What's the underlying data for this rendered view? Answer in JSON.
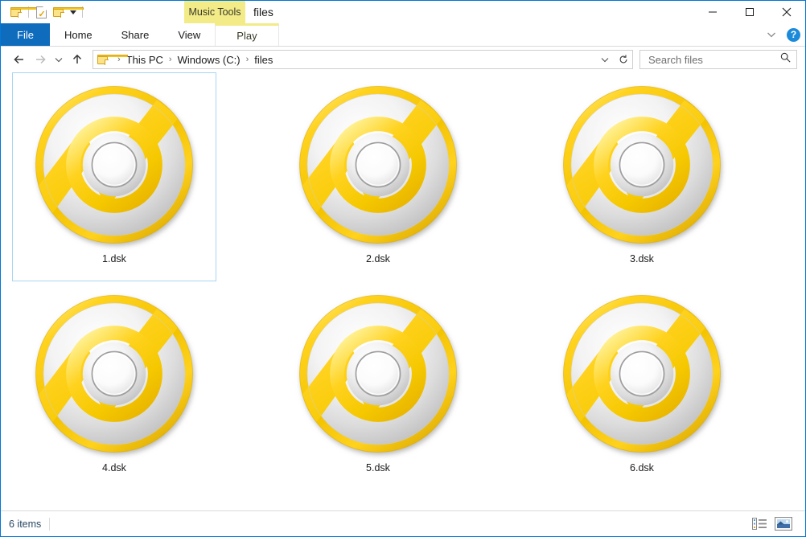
{
  "window": {
    "title": "files",
    "contextual_tab_group": "Music Tools",
    "colors": {
      "accent": "#0078d7",
      "file_tab": "#0f6cbd",
      "contextual": "#f2eb87",
      "selection_border": "#a9d5f2",
      "disc_gold": "#ffd21e",
      "disc_silver": "#e8e8e8"
    }
  },
  "quick_access": {
    "items": [
      {
        "name": "folder-icon",
        "label": ""
      },
      {
        "name": "properties-icon",
        "label": ""
      },
      {
        "name": "new-folder-icon",
        "label": ""
      },
      {
        "name": "customize-caret",
        "label": ""
      }
    ]
  },
  "window_controls": {
    "minimize": "—",
    "maximize": "□",
    "close": "✕",
    "help": "?"
  },
  "ribbon": {
    "tabs": [
      {
        "label": "File",
        "active": false,
        "type": "file"
      },
      {
        "label": "Home",
        "active": false,
        "type": "normal"
      },
      {
        "label": "Share",
        "active": false,
        "type": "normal"
      },
      {
        "label": "View",
        "active": false,
        "type": "normal"
      },
      {
        "label": "Play",
        "active": true,
        "type": "contextual"
      }
    ]
  },
  "address_bar": {
    "back": "←",
    "forward": "→",
    "recent_caret": "⌄",
    "up": "↑",
    "breadcrumbs": [
      "This PC",
      "Windows (C:)",
      "files"
    ],
    "separator": "›",
    "refresh": "↻"
  },
  "search": {
    "placeholder": "Search files",
    "value": ""
  },
  "files": [
    {
      "name": "1.dsk",
      "selected": true
    },
    {
      "name": "2.dsk",
      "selected": false
    },
    {
      "name": "3.dsk",
      "selected": false
    },
    {
      "name": "4.dsk",
      "selected": false
    },
    {
      "name": "5.dsk",
      "selected": false
    },
    {
      "name": "6.dsk",
      "selected": false
    }
  ],
  "status_bar": {
    "item_count": "6 items",
    "views": [
      {
        "name": "details-view-button",
        "active": false
      },
      {
        "name": "large-icons-view-button",
        "active": true
      }
    ]
  }
}
